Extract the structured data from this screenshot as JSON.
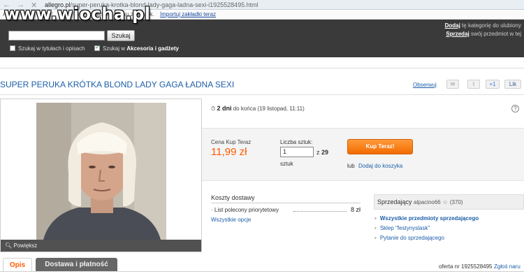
{
  "browser": {
    "url_domain": "allegro.pl",
    "url_path": "/super-peruka-krotka-blond-lady-gaga-ladna-sexi-i1925528495.html",
    "bookmark_prefix": "Aby",
    "bookmark_text": "ym miejscu na pasku zakładek.",
    "bookmark_link": "Importuj zakładki teraz"
  },
  "watermark": "www.wiocha.pl",
  "header": {
    "search_placeholder": "",
    "search_button": "Szukaj",
    "opt_titles": "Szukaj w tytułach i opisach",
    "opt_category_prefix": "Szukaj w",
    "opt_category": "Akcesoria i gadżety",
    "add_link": "Dodaj",
    "add_text": "tę kategorię do ulubiony",
    "sell_link": "Sprzedaj",
    "sell_text": "swój przedmiot w tej"
  },
  "product": {
    "title": "SUPER PERUKA KRÓTKA BLOND LADY GAGA ŁADNA SEXI",
    "observe": "Obserwuj",
    "share_plus": "+1",
    "zoom": "Powiększ",
    "time_bold": "2 dni",
    "time_rest": "do końca (19 listopad, 11:11)",
    "price_label": "Cena Kup Teraz",
    "price": "11,99 zł",
    "qty_label": "Liczba sztuk:",
    "qty_value": "1",
    "qty_of": "z",
    "qty_max": "29",
    "qty_unit": "sztuk",
    "buy_button": "Kup Teraz!",
    "or": "lub",
    "add_to_cart": "Dodaj do koszyka"
  },
  "shipping": {
    "title": "Koszty dostawy",
    "method": "List polecony priorytetowy",
    "cost": "8 zł",
    "all_options": "Wszystkie opcje"
  },
  "seller": {
    "label": "Sprzedający",
    "nick": "alpacino66",
    "rating": "(370)",
    "link_all": "Wszystkie przedmioty sprzedającego",
    "link_shop": "Sklep \"festynyslask\"",
    "link_ask": "Pytanie do sprzedającego"
  },
  "tabs": [
    "Opis",
    "Dostawa i płatność"
  ],
  "footer": {
    "offer": "oferta nr 1925528495",
    "report": "Zgłoś naru"
  }
}
